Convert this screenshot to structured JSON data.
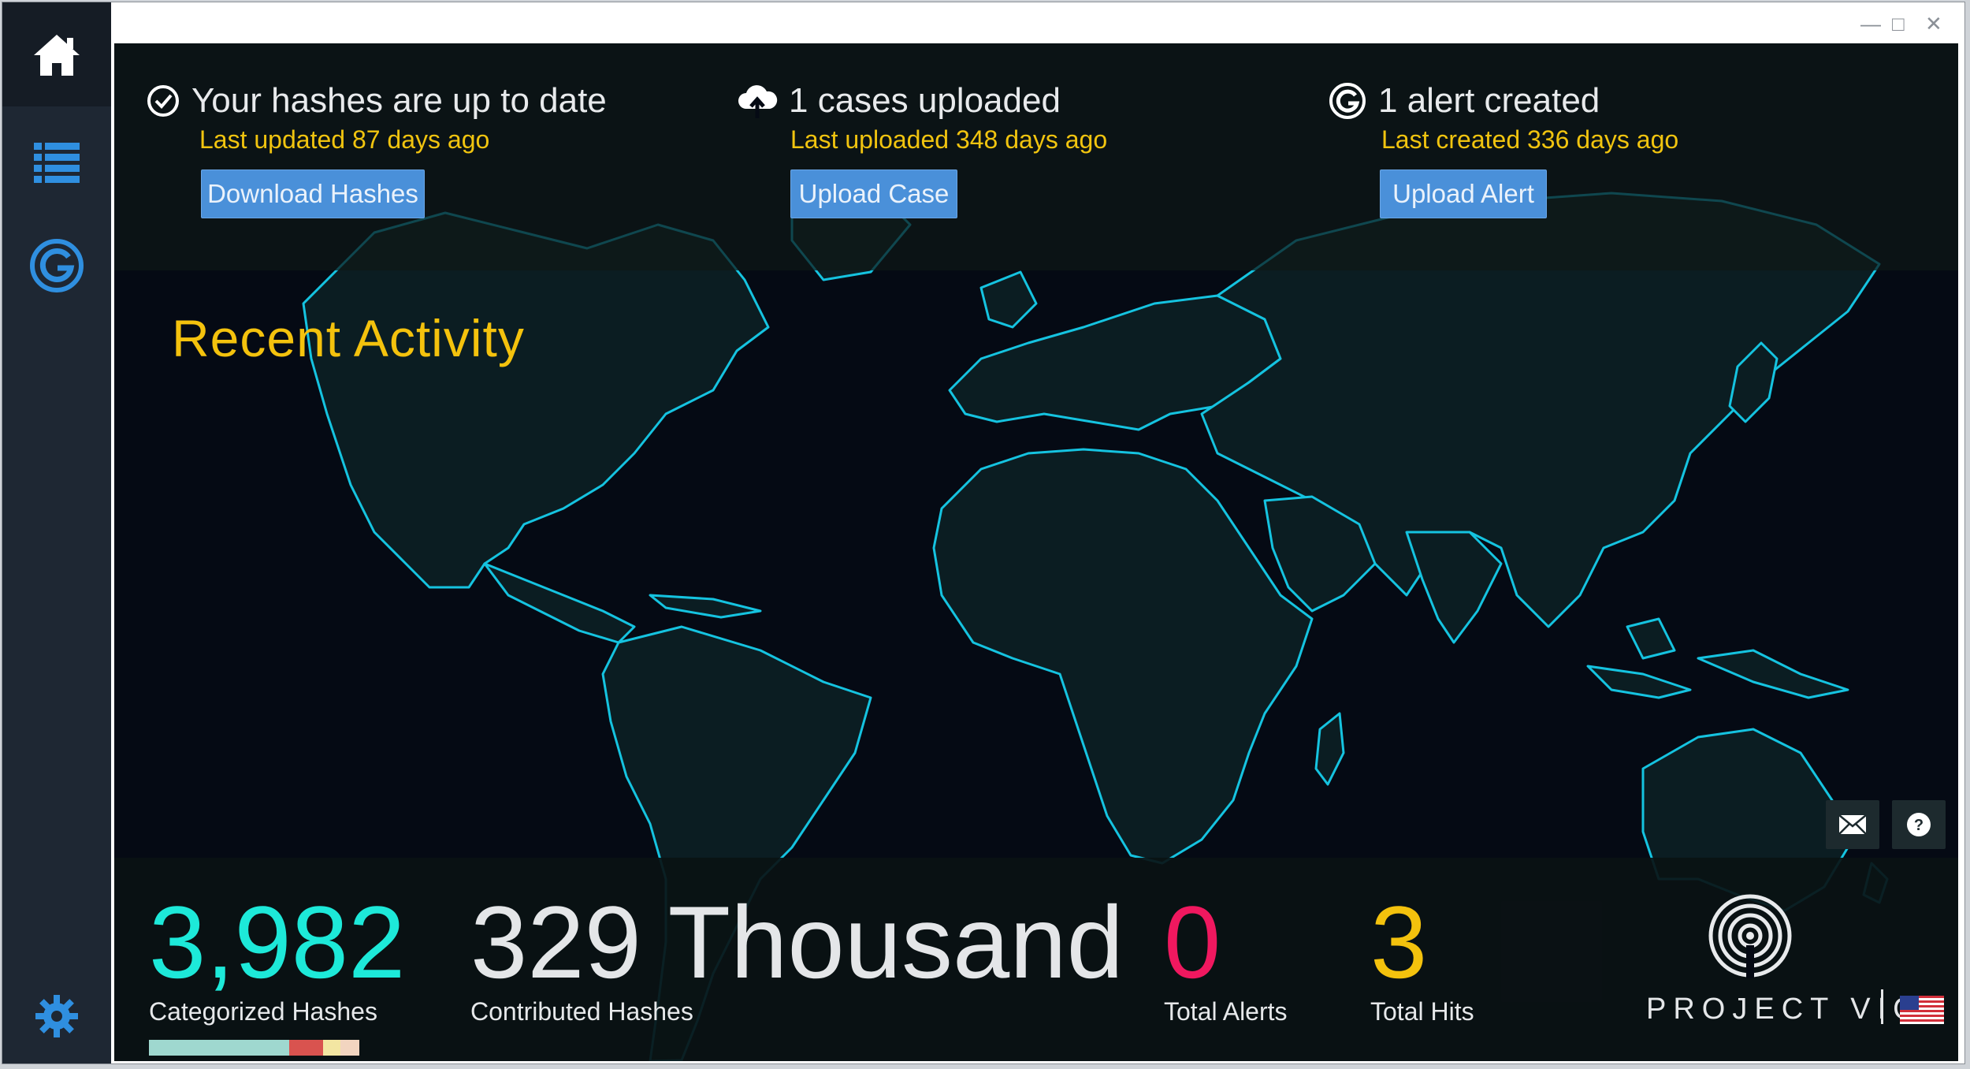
{
  "sidebar": {
    "items": [
      {
        "name": "home",
        "icon": "home-icon",
        "active": true
      },
      {
        "name": "list",
        "icon": "list-icon",
        "active": false
      },
      {
        "name": "alerts",
        "icon": "project-vic-g-icon",
        "active": false
      }
    ],
    "settings_icon": "gear-icon"
  },
  "window_controls": [
    "minimize-icon",
    "maximize-icon",
    "close-icon"
  ],
  "status": {
    "hashes": {
      "title": "Your hashes are up to date",
      "sub": "Last updated 87 days ago",
      "button": "Download Hashes",
      "icon": "check-circle-icon"
    },
    "cases": {
      "title": "1 cases uploaded",
      "sub": "Last uploaded 348 days ago",
      "button": "Upload Case",
      "icon": "cloud-upload-icon"
    },
    "alerts": {
      "title": "1 alert created",
      "sub": "Last created 336 days ago",
      "button": "Upload Alert",
      "icon": "alert-g-icon"
    }
  },
  "recent_activity_title": "Recent Activity",
  "stats": {
    "categorized": {
      "value": "3,982",
      "label": "Categorized Hashes",
      "color": "#1de9d9"
    },
    "contributed": {
      "value": "329 Thousand",
      "label": "Contributed Hashes",
      "color": "#e4e6e8"
    },
    "alerts": {
      "value": "0",
      "label": "Total Alerts",
      "color": "#f0185f"
    },
    "hits": {
      "value": "3",
      "label": "Total Hits",
      "color": "#f4c20d"
    }
  },
  "category_bar": [
    {
      "fraction": 0.66,
      "color": "#9fd8cf"
    },
    {
      "fraction": 0.16,
      "color": "#d9534f"
    },
    {
      "fraction": 0.08,
      "color": "#f3e6a2"
    },
    {
      "fraction": 0.09,
      "color": "#f2d5c0"
    }
  ],
  "floating_buttons": [
    "envelope-icon",
    "help-icon"
  ],
  "logo": {
    "text": "PROJECT VIC",
    "flag_icon": "us-flag-icon"
  },
  "colors": {
    "accent_blue": "#4a90d9",
    "yellow": "#f4c20d",
    "map_outline": "#15c3e0"
  }
}
